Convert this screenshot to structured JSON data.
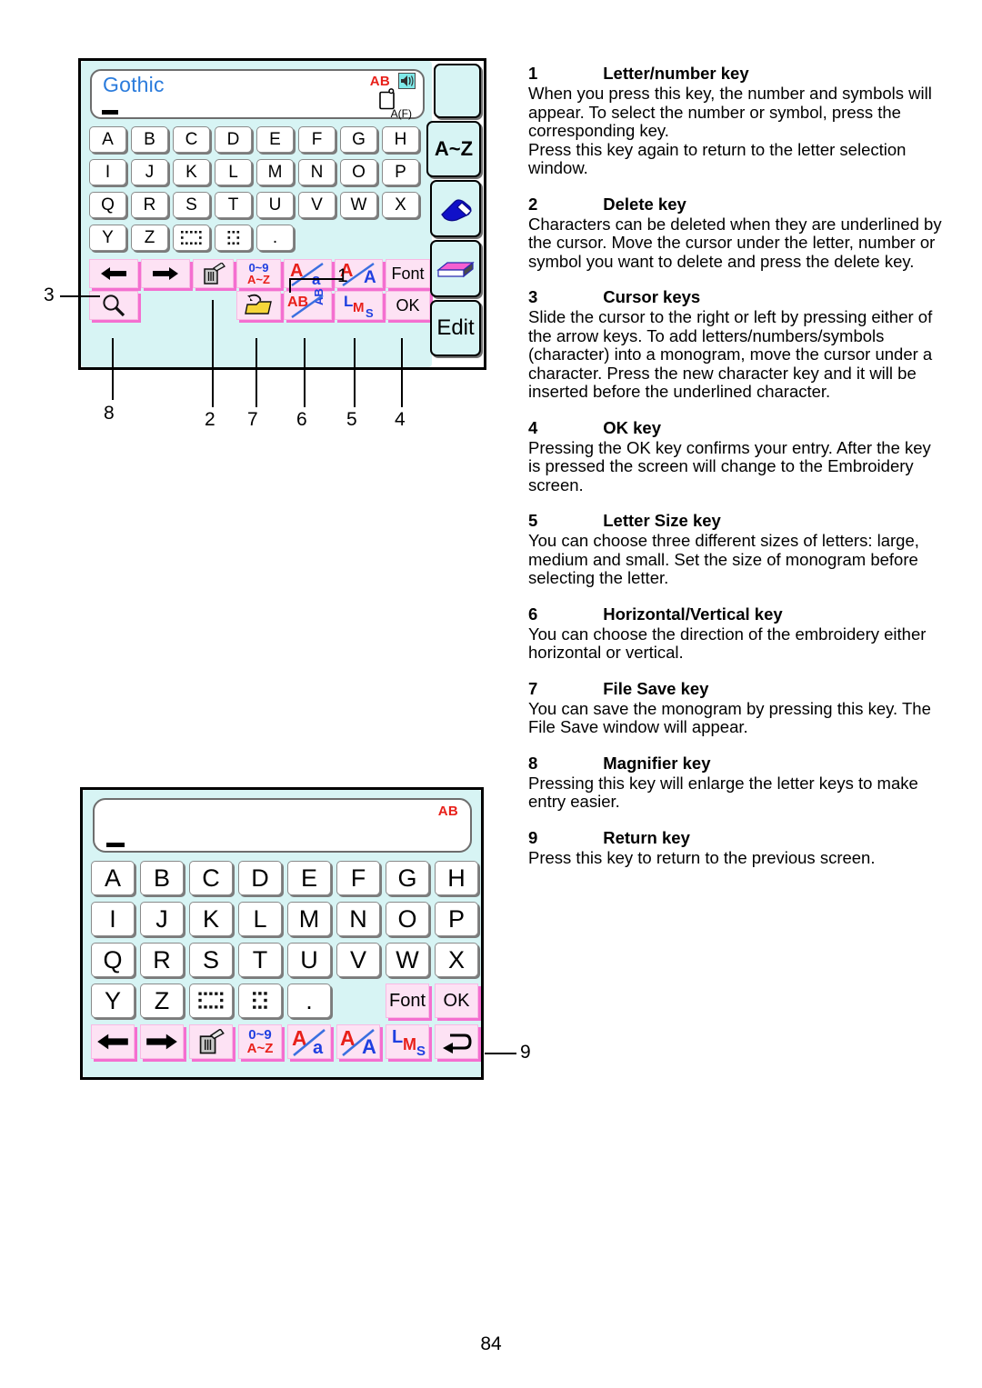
{
  "page": {
    "number": "84"
  },
  "upper_panel": {
    "name": "monogram-letter-entry-screen",
    "display": {
      "font_name": "Gothic",
      "ab_indicator": "AB",
      "sound_icon": "speaker-icon",
      "file_icon": "hoop-icon",
      "file_label": "A(F)"
    },
    "keys": {
      "row1": [
        "A",
        "B",
        "C",
        "D",
        "E",
        "F",
        "G",
        "H"
      ],
      "row2": [
        "I",
        "J",
        "K",
        "L",
        "M",
        "N",
        "O",
        "P"
      ],
      "row3": [
        "Q",
        "R",
        "S",
        "T",
        "U",
        "V",
        "W",
        "X"
      ],
      "row4": [
        "Y",
        "Z",
        "",
        "",
        ". "
      ]
    },
    "row4_icons": [
      "space-wide-icon",
      "space-narrow-icon"
    ],
    "row4_period": ".",
    "function_row1": [
      {
        "name": "cursor-left-key",
        "label": "←"
      },
      {
        "name": "cursor-right-key",
        "label": "→"
      },
      {
        "name": "delete-key",
        "label": "delete-icon"
      },
      {
        "name": "letter-number-key",
        "label": "0~9 / A~Z"
      },
      {
        "name": "upper-lower-case-key",
        "label": "A/a"
      },
      {
        "name": "horizontal-vertical-key",
        "label": "A/A"
      },
      {
        "name": "font-key",
        "label": "Font"
      }
    ],
    "function_row2": [
      {
        "name": "magnifier-key",
        "label": "magnifier-icon"
      },
      {
        "name": "file-save-key",
        "label": "folder-icon"
      },
      {
        "name": "ab-ab-key",
        "label": "AB/AB"
      },
      {
        "name": "letter-size-key",
        "label": "L M S"
      },
      {
        "name": "ok-key",
        "label": "OK"
      }
    ],
    "function_labels": {
      "num_top": "0~9",
      "num_bottom": "A~Z",
      "aa_upper": "A",
      "aa_lower": "a",
      "hv_upper": "A",
      "hv_lower": "A",
      "ab_upper": "AB",
      "ab_lower": "AB",
      "size_l": "L",
      "size_m": "M",
      "size_s": "S",
      "font": "Font",
      "ok": "OK"
    },
    "side_tabs": [
      {
        "name": "tab-blank",
        "label": ""
      },
      {
        "name": "tab-a-to-z",
        "label": "A~Z"
      },
      {
        "name": "tab-eraser-blue",
        "label": "blue-eraser-icon"
      },
      {
        "name": "tab-eraser-pink",
        "label": "pink-eraser-icon"
      },
      {
        "name": "tab-edit",
        "label": "Edit"
      }
    ],
    "callouts": [
      "1",
      "2",
      "3",
      "4",
      "5",
      "6",
      "7",
      "8"
    ]
  },
  "lower_panel": {
    "name": "magnified-letter-entry-screen",
    "display": {
      "ab_indicator": "AB"
    },
    "keys": {
      "row1": [
        "A",
        "B",
        "C",
        "D",
        "E",
        "F",
        "G",
        "H"
      ],
      "row2": [
        "I",
        "J",
        "K",
        "L",
        "M",
        "N",
        "O",
        "P"
      ],
      "row3": [
        "Q",
        "R",
        "S",
        "T",
        "U",
        "V",
        "W",
        "X"
      ],
      "row4": [
        "Y",
        "Z"
      ]
    },
    "row4_period": ".",
    "font_key": "Font",
    "ok_key": "OK",
    "function_row": [
      {
        "name": "cursor-left-key",
        "label": "←"
      },
      {
        "name": "cursor-right-key",
        "label": "→"
      },
      {
        "name": "delete-key",
        "label": "delete-icon"
      },
      {
        "name": "letter-number-key",
        "label": "0~9 / A~Z"
      },
      {
        "name": "upper-lower-case-key",
        "label": "A/a"
      },
      {
        "name": "horizontal-vertical-key",
        "label": "A/A"
      },
      {
        "name": "letter-size-key",
        "label": "L M S"
      },
      {
        "name": "return-key",
        "label": "return-arrow-icon"
      }
    ],
    "function_labels": {
      "num_top": "0~9",
      "num_bottom": "A~Z",
      "aa_upper": "A",
      "aa_lower": "a",
      "hv_upper": "A",
      "hv_lower": "A",
      "size_l": "L",
      "size_m": "M",
      "size_s": "S"
    },
    "callouts": [
      "9"
    ]
  },
  "descriptions": [
    {
      "num": "1",
      "title": "Letter/number key",
      "body": "When you press this key, the number and symbols will appear. To select the number or symbol, press the corresponding key.\nPress this key again to return to the letter selection window."
    },
    {
      "num": "2",
      "title": "Delete key",
      "body": "Characters can be deleted when they are underlined by the cursor. Move the cursor under the letter, number or symbol you want to delete and press the delete key."
    },
    {
      "num": "3",
      "title": "Cursor keys",
      "body": "Slide the cursor to the right or left by pressing either of the arrow keys. To add letters/numbers/symbols (character) into a monogram, move the cursor under a character. Press the new character key and it will be inserted before the underlined character."
    },
    {
      "num": "4",
      "title": "OK key",
      "body": "Pressing the OK key confirms your entry. After the key is pressed the screen will change to the Embroidery screen."
    },
    {
      "num": "5",
      "title": "Letter Size key",
      "body": "You can choose three different sizes of letters: large, medium and small. Set the size of monogram before selecting the letter."
    },
    {
      "num": "6",
      "title": "Horizontal/Vertical key",
      "body": "You can choose the direction of the embroidery either horizontal or vertical."
    },
    {
      "num": "7",
      "title": "File Save key",
      "body": "You can save the monogram by pressing this key. The File Save window will appear."
    },
    {
      "num": "8",
      "title": "Magnifier key",
      "body": "Pressing this key will enlarge the letter keys to make entry easier."
    },
    {
      "num": "9",
      "title": "Return key",
      "body": "Press this key to return to the previous screen."
    }
  ],
  "colors": {
    "lcd_bg": "#d7f4f4",
    "key_bg": "#ffffff",
    "fkey_bg": "#fde2f4",
    "fkey_shadow": "#f46fd0",
    "accent_red": "#e8201a",
    "accent_blue": "#1f3fe0",
    "gothic_blue": "#2a7bdc"
  }
}
